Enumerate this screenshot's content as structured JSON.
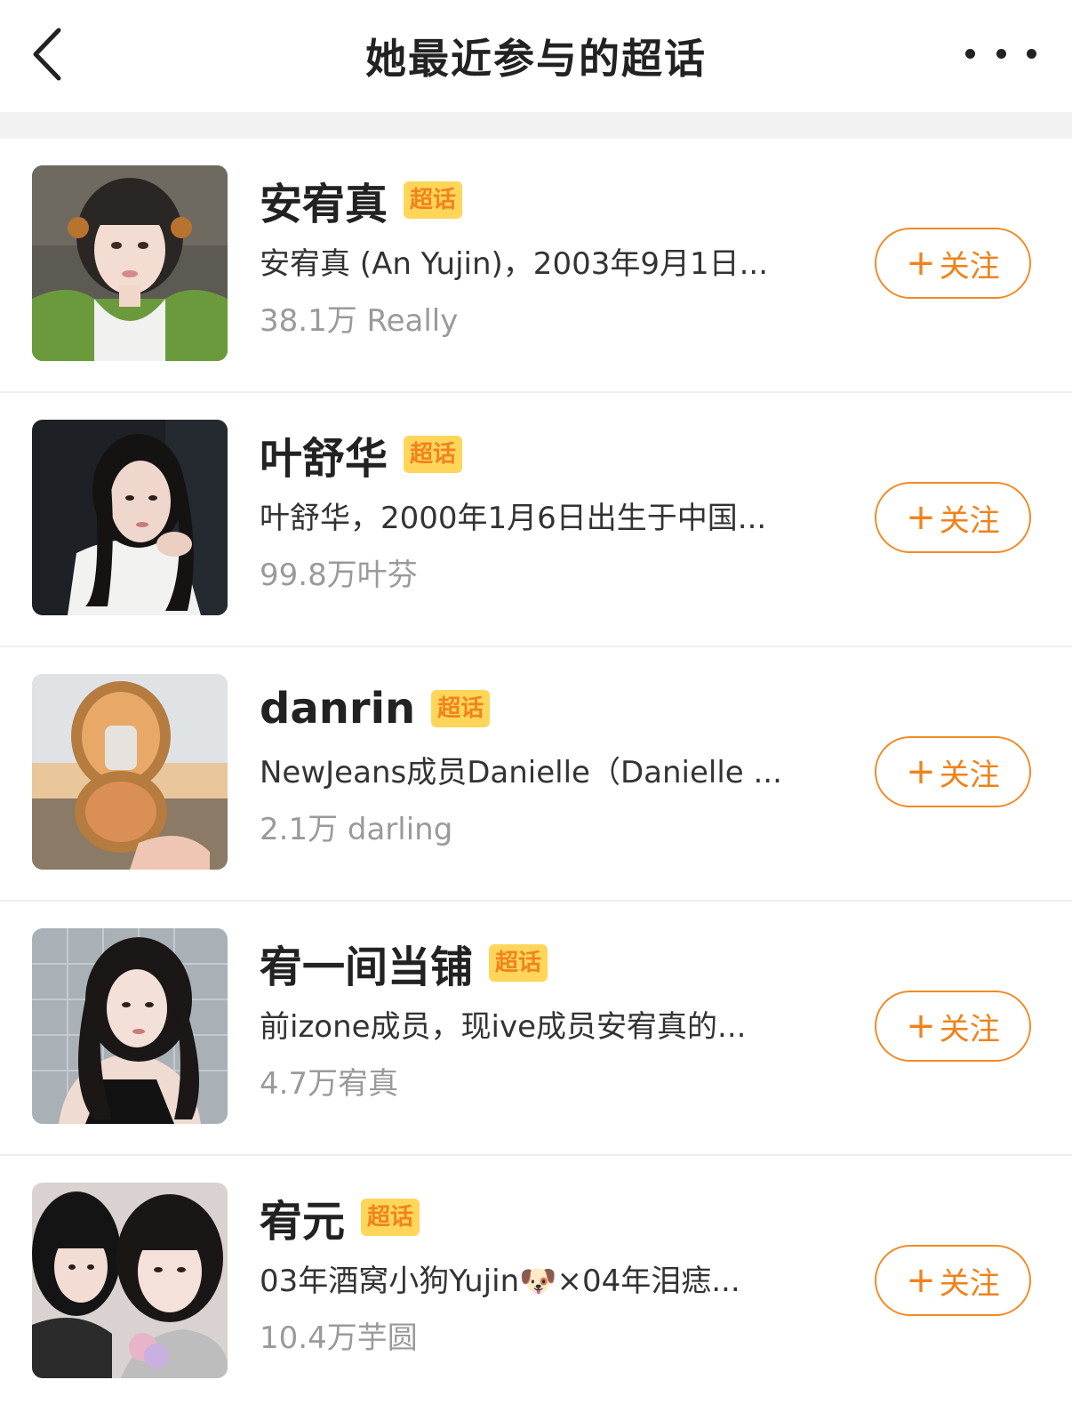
{
  "nav": {
    "title": "她最近参与的超话"
  },
  "icons": {
    "back": "chevron-left-icon",
    "more": "more-dots-icon"
  },
  "colors": {
    "accent": "#f0821a",
    "badge_bg": "#ffd65a",
    "badge_text": "#f2821e",
    "secondary_text": "#9a9a9a"
  },
  "topics": [
    {
      "name": "安宥真",
      "badge": "超话",
      "desc": "安宥真 (An Yujin)，2003年9月1日...",
      "count": "38.1万 Really",
      "follow_plus": "+",
      "follow_label": "关注"
    },
    {
      "name": "叶舒华",
      "badge": "超话",
      "desc": "叶舒华，2000年1月6日出生于中国...",
      "count": "99.8万叶芬",
      "follow_plus": "+",
      "follow_label": "关注"
    },
    {
      "name": "danrin",
      "badge": "超话",
      "desc": "NewJeans成员Danielle（Danielle ...",
      "count": "2.1万 darling",
      "follow_plus": "+",
      "follow_label": "关注"
    },
    {
      "name": "宥一间当铺",
      "badge": "超话",
      "desc": "前izone成员，现ive成员安宥真的...",
      "count": "4.7万宥真",
      "follow_plus": "+",
      "follow_label": "关注"
    },
    {
      "name": "宥元",
      "badge": "超话",
      "desc": "03年酒窝小狗Yujin🐶×04年泪痣...",
      "count": "10.4万芋圆",
      "follow_plus": "+",
      "follow_label": "关注"
    }
  ]
}
